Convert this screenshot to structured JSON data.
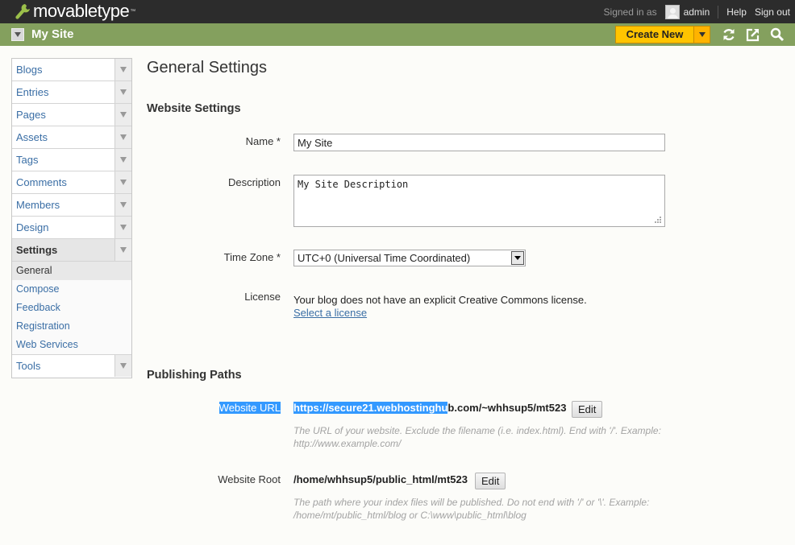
{
  "topbar": {
    "logo_text": "movabletype",
    "logo_tm": "™",
    "signed_in_label": "Signed in as",
    "username": "admin",
    "help_label": "Help",
    "signout_label": "Sign out"
  },
  "sitebar": {
    "site_name": "My Site",
    "create_new_label": "Create New"
  },
  "sidebar": {
    "items": [
      {
        "label": "Blogs"
      },
      {
        "label": "Entries"
      },
      {
        "label": "Pages"
      },
      {
        "label": "Assets"
      },
      {
        "label": "Tags"
      },
      {
        "label": "Comments"
      },
      {
        "label": "Members"
      },
      {
        "label": "Design"
      },
      {
        "label": "Settings"
      },
      {
        "label": "Tools"
      }
    ],
    "settings_submenu": [
      {
        "label": "General"
      },
      {
        "label": "Compose"
      },
      {
        "label": "Feedback"
      },
      {
        "label": "Registration"
      },
      {
        "label": "Web Services"
      }
    ]
  },
  "main": {
    "page_title": "General Settings",
    "website_settings": {
      "section_title": "Website Settings",
      "name_label": "Name *",
      "name_value": "My Site",
      "description_label": "Description",
      "description_value": "My Site Description",
      "timezone_label": "Time Zone *",
      "timezone_value": "UTC+0 (Universal Time Coordinated)",
      "license_label": "License",
      "license_text": "Your blog does not have an explicit Creative Commons license.",
      "license_link": "Select a license"
    },
    "publishing_paths": {
      "section_title": "Publishing Paths",
      "url_label": "Website URL",
      "url_value_selected": "https://secure21.webhostinghu",
      "url_value_rest": "b.com/~whhsup5/mt523",
      "url_edit_label": "Edit",
      "url_hint": "The URL of your website. Exclude the filename (i.e. index.html). End with '/'. Example: http://www.example.com/",
      "root_label": "Website Root",
      "root_value": "/home/whhsup5/public_html/mt523",
      "root_edit_label": "Edit",
      "root_hint": "The path where your index files will be published. Do not end with '/' or '\\'. Example: /home/mt/public_html/blog or C:\\www\\public_html\\blog"
    }
  }
}
